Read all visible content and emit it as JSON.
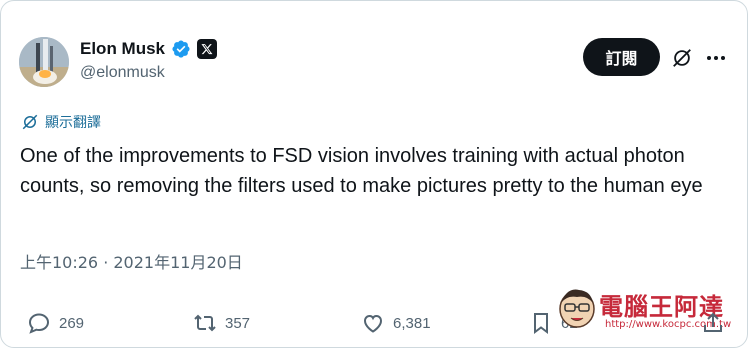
{
  "author": {
    "name": "Elon Musk",
    "handle": "@elonmusk",
    "verified": true
  },
  "header": {
    "subscribe_label": "訂閱"
  },
  "translate_label": "顯示翻譯",
  "tweet": {
    "text": "One of the improvements to FSD vision involves training with actual photon counts, so removing the filters used to make pictures pretty to the human eye",
    "timestamp": "上午10:26 · 2021年11月20日"
  },
  "actions": {
    "replies": "269",
    "reposts": "357",
    "likes": "6,381",
    "bookmarks": "62"
  },
  "watermark": {
    "text": "電腦王阿達",
    "url": "http://www.kocpc.com.tw"
  },
  "colors": {
    "verified_blue": "#1d9bf0",
    "text": "#0f1419",
    "secondary": "#536471",
    "translate": "#1d6e99"
  }
}
